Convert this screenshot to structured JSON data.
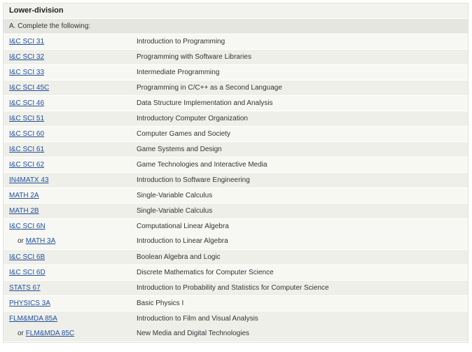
{
  "section": {
    "title": "Lower-division",
    "subtitle": "A. Complete the following:"
  },
  "rows": [
    {
      "lines": [
        {
          "code": "I&C SCI 31",
          "title": "Introduction to Programming"
        }
      ]
    },
    {
      "lines": [
        {
          "code": "I&C SCI 32",
          "title": "Programming with Software Libraries"
        }
      ]
    },
    {
      "lines": [
        {
          "code": "I&C SCI 33",
          "title": "Intermediate Programming"
        }
      ]
    },
    {
      "lines": [
        {
          "code": "I&C SCI 45C",
          "title": "Programming in C/C++ as a Second Language"
        }
      ]
    },
    {
      "lines": [
        {
          "code": "I&C SCI 46",
          "title": "Data Structure Implementation and Analysis"
        }
      ]
    },
    {
      "lines": [
        {
          "code": "I&C SCI 51",
          "title": "Introductory Computer Organization"
        }
      ]
    },
    {
      "lines": [
        {
          "code": "I&C SCI 60",
          "title": "Computer Games and Society"
        }
      ]
    },
    {
      "lines": [
        {
          "code": "I&C SCI 61",
          "title": "Game Systems and Design"
        }
      ]
    },
    {
      "lines": [
        {
          "code": "I&C SCI 62",
          "title": "Game Technologies and Interactive Media"
        }
      ]
    },
    {
      "lines": [
        {
          "code": "IN4MATX 43",
          "title": "Introduction to Software Engineering"
        }
      ]
    },
    {
      "lines": [
        {
          "code": "MATH 2A",
          "title": "Single-Variable Calculus"
        }
      ]
    },
    {
      "lines": [
        {
          "code": "MATH 2B",
          "title": "Single-Variable Calculus"
        }
      ]
    },
    {
      "lines": [
        {
          "code": "I&C SCI 6N",
          "title": "Computational Linear Algebra"
        },
        {
          "prefix": "or",
          "code": "MATH 3A",
          "title": "Introduction to Linear Algebra"
        }
      ]
    },
    {
      "lines": [
        {
          "code": "I&C SCI 6B",
          "title": "Boolean Algebra and Logic"
        }
      ]
    },
    {
      "lines": [
        {
          "code": "I&C SCI 6D",
          "title": "Discrete Mathematics for Computer Science"
        }
      ]
    },
    {
      "lines": [
        {
          "code": "STATS 67",
          "title": "Introduction to Probability and Statistics for Computer Science"
        }
      ]
    },
    {
      "lines": [
        {
          "code": "PHYSICS 3A",
          "title": "Basic Physics I"
        }
      ]
    },
    {
      "lines": [
        {
          "code": "FLM&MDA 85A",
          "title": "Introduction to Film and Visual Analysis"
        },
        {
          "prefix": "or",
          "code": "FLM&MDA 85C",
          "title": "New Media and Digital Technologies"
        }
      ]
    }
  ]
}
